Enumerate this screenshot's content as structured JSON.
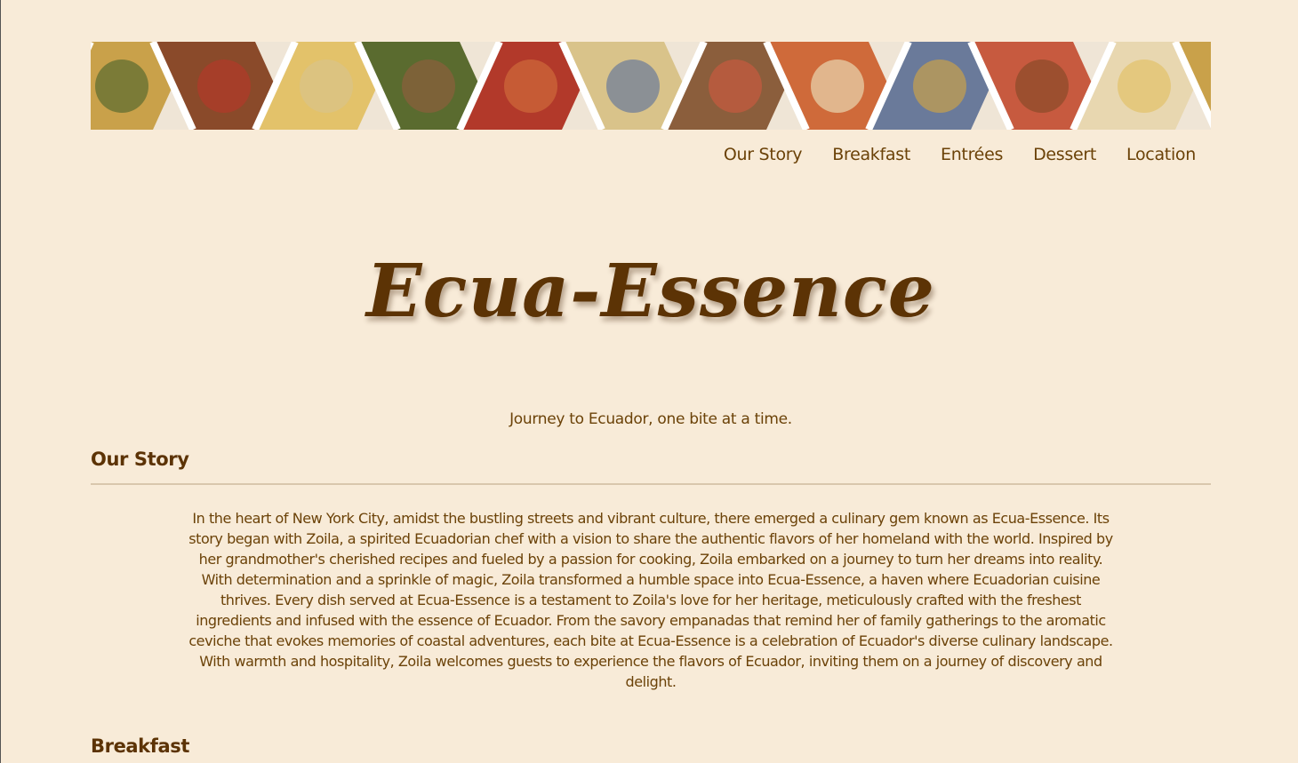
{
  "banner": {
    "alt": "food collage banner",
    "colors": [
      "#c9a14a",
      "#8a4a2a",
      "#e3c26a",
      "#5a6b2f",
      "#b2392a",
      "#d9c38a",
      "#8b5e3c",
      "#cf6a3a",
      "#6a7a9a",
      "#c75a3f",
      "#e8d7b0"
    ]
  },
  "nav": {
    "items": [
      {
        "label": "Our Story"
      },
      {
        "label": "Breakfast"
      },
      {
        "label": "Entrées"
      },
      {
        "label": "Dessert"
      },
      {
        "label": "Location"
      }
    ]
  },
  "header": {
    "title": "Ecua-Essence",
    "tagline": "Journey to Ecuador, one bite at a time."
  },
  "sections": {
    "our_story": {
      "heading": "Our Story",
      "paragraph1": "In the heart of New York City, amidst the bustling streets and vibrant culture, there emerged a culinary gem known as Ecua-Essence. Its story began with Zoila, a spirited Ecuadorian chef with a vision to share the authentic flavors of her homeland with the world. Inspired by her grandmother's cherished recipes and fueled by a passion for cooking, Zoila embarked on a journey to turn her dreams into reality.",
      "paragraph2": "With determination and a sprinkle of magic, Zoila transformed a humble space into Ecua-Essence, a haven where Ecuadorian cuisine thrives. Every dish served at Ecua-Essence is a testament to Zoila's love for her heritage, meticulously crafted with the freshest ingredients and infused with the essence of Ecuador. From the savory empanadas that remind her of family gatherings to the aromatic ceviche that evokes memories of coastal adventures, each bite at Ecua-Essence is a celebration of Ecuador's diverse culinary landscape. With warmth and hospitality, Zoila welcomes guests to experience the flavors of Ecuador, inviting them on a journey of discovery and delight."
    },
    "breakfast": {
      "heading": "Breakfast"
    }
  }
}
